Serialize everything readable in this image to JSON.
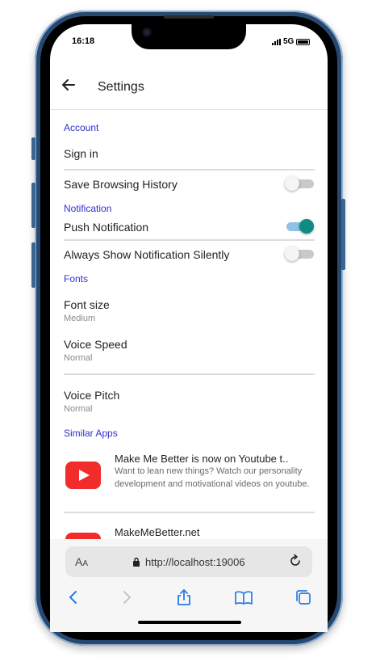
{
  "status_bar": {
    "time": "16:18",
    "network": "5G"
  },
  "header": {
    "title": "Settings"
  },
  "sections": {
    "account": {
      "title": "Account",
      "sign_in": "Sign in",
      "save_history": {
        "label": "Save Browsing History",
        "enabled": false
      }
    },
    "notification": {
      "title": "Notification",
      "push": {
        "label": "Push Notification",
        "enabled": true
      },
      "silent": {
        "label": "Always Show Notification Silently",
        "enabled": false
      }
    },
    "fonts": {
      "title": "Fonts",
      "font_size": {
        "label": "Font size",
        "value": "Medium"
      },
      "voice_speed": {
        "label": "Voice Speed",
        "value": "Normal"
      },
      "voice_pitch": {
        "label": "Voice Pitch",
        "value": "Normal"
      }
    },
    "similar_apps": {
      "title": "Similar Apps",
      "items": [
        {
          "name": "Make Me Better is now on Youtube t..",
          "description": "Want to lean new things? Watch our personality development and motivational videos on youtube."
        },
        {
          "name": "MakeMeBetter.net",
          "description": ""
        }
      ]
    }
  },
  "browser": {
    "text_size_label_big": "A",
    "text_size_label_small": "A",
    "url": "http://localhost:19006"
  },
  "colors": {
    "accent": "#2f2fd1",
    "toggle_on": "#108a82",
    "youtube_red": "#f22b2b"
  }
}
